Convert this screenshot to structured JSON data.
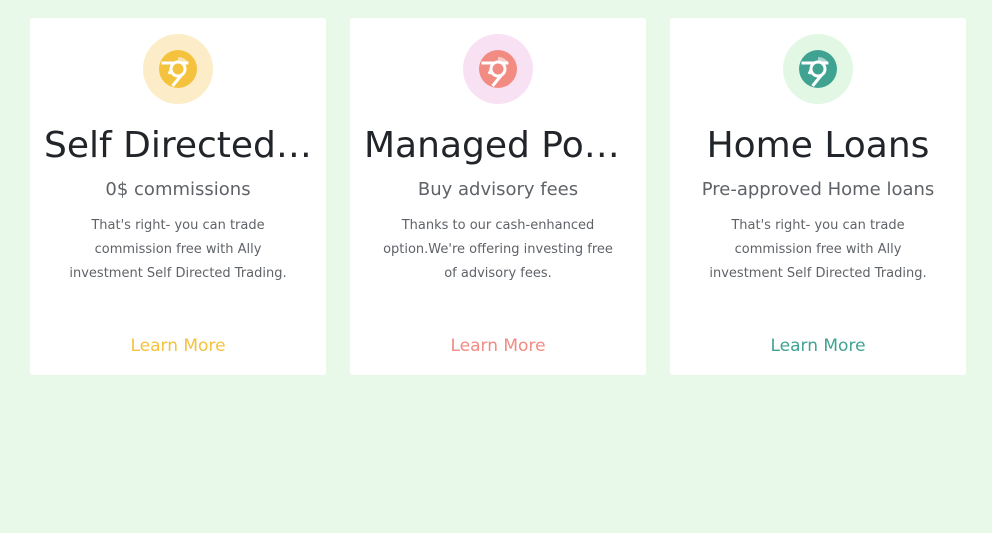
{
  "cards": [
    {
      "title": "Self Directed Trading",
      "subtitle": "0$ commissions",
      "text": "That's right- you can trade commission free with Ally investment Self Directed Trading.",
      "link_label": "Learn More",
      "icon": "chrome-icon",
      "accent_color": "#f5c23d",
      "icon_bg_color": "#fcedc8"
    },
    {
      "title": "Managed Portfolios",
      "subtitle": "Buy advisory fees",
      "text": "Thanks to our cash-enhanced option.We're offering investing free of advisory fees.",
      "link_label": "Learn More",
      "icon": "chrome-icon",
      "accent_color": "#f28b82",
      "icon_bg_color": "#f8e1f3"
    },
    {
      "title": "Home Loans",
      "subtitle": "Pre-approved Home loans",
      "text": "That's right- you can trade commission free with Ally investment Self Directed Trading.",
      "link_label": "Learn More",
      "icon": "chrome-icon",
      "accent_color": "#40a392",
      "icon_bg_color": "#e2f8e4"
    }
  ]
}
